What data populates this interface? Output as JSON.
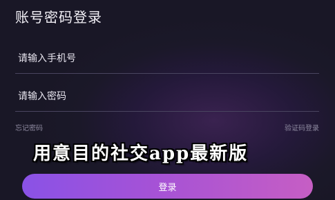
{
  "header": {
    "title": "账号密码登录"
  },
  "form": {
    "phone_placeholder": "请输入手机号",
    "password_placeholder": "请输入密码",
    "forgot_password": "忘记密码",
    "code_login": "验证码登录",
    "login_button": "登录"
  },
  "overlay": {
    "caption": "用意目的社交app最新版"
  },
  "colors": {
    "background": "#1b1829",
    "button_start": "#8a52e6",
    "button_end": "#c65ec4"
  }
}
